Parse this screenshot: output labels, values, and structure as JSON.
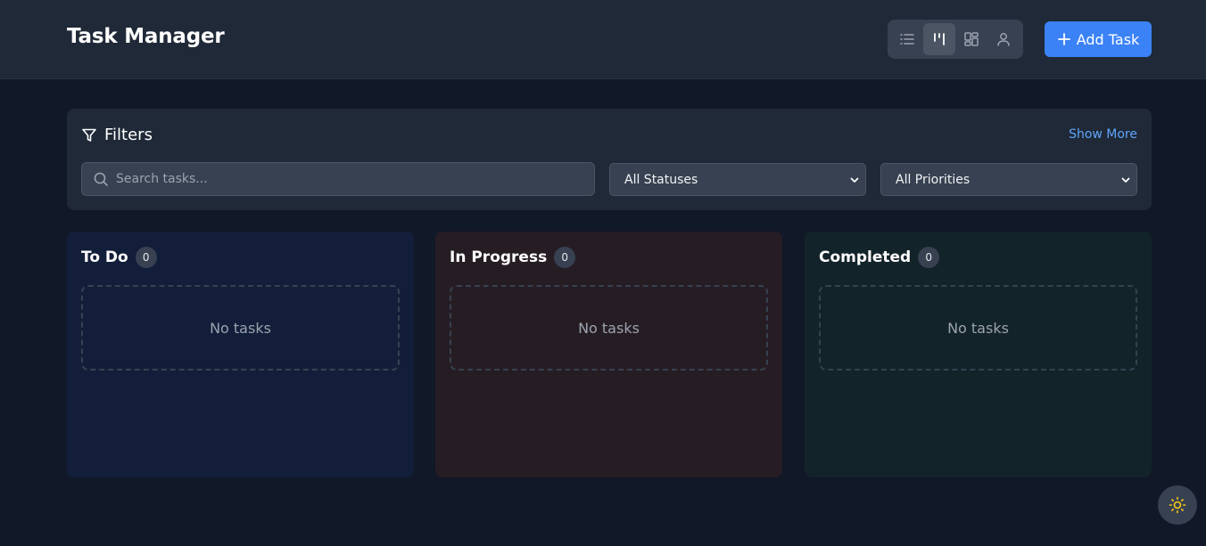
{
  "header": {
    "title": "Task Manager",
    "view_modes": [
      {
        "name": "list",
        "icon": "list-icon",
        "active": false
      },
      {
        "name": "kanban",
        "icon": "kanban-icon",
        "active": true
      },
      {
        "name": "grid",
        "icon": "grid-icon",
        "active": false
      },
      {
        "name": "user",
        "icon": "user-icon",
        "active": false
      }
    ],
    "add_task_label": "Add Task"
  },
  "filters": {
    "title": "Filters",
    "show_more_label": "Show More",
    "search": {
      "placeholder": "Search tasks...",
      "value": ""
    },
    "status_select": {
      "selected": "All Statuses"
    },
    "priority_select": {
      "selected": "All Priorities"
    }
  },
  "columns": [
    {
      "title": "To Do",
      "count": "0",
      "empty_text": "No tasks",
      "color": "#131e3a"
    },
    {
      "title": "In Progress",
      "count": "0",
      "empty_text": "No tasks",
      "color": "#261d24"
    },
    {
      "title": "Completed",
      "count": "0",
      "empty_text": "No tasks",
      "color": "#13232a"
    }
  ],
  "theme_toggle": {
    "icon": "sun-icon",
    "color": "#facc15"
  },
  "colors": {
    "accent": "#3b82f6",
    "background": "#111827",
    "surface": "#1f2937"
  }
}
